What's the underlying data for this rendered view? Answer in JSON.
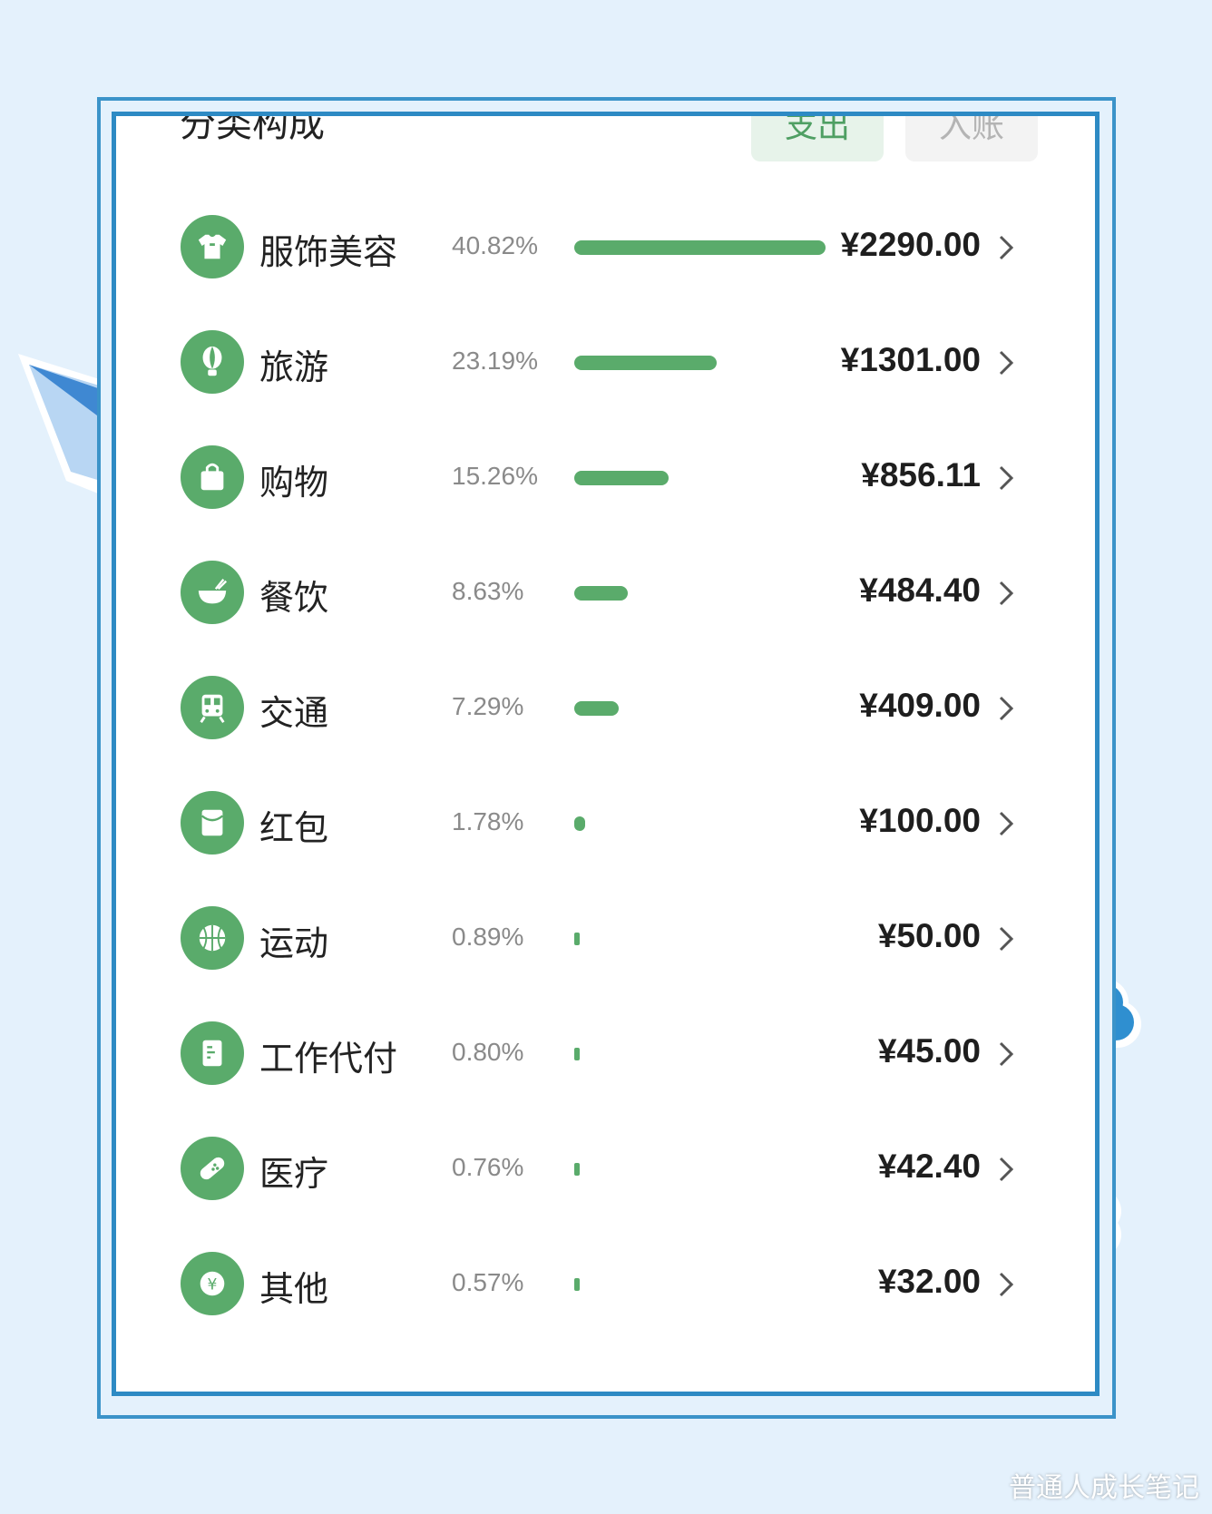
{
  "header": {
    "title": "分类构成",
    "tab_expense": "支出",
    "tab_income": "入账"
  },
  "colors": {
    "accent": "#5aab6b",
    "frame": "#2d8ac4",
    "background": "#e4f1fc"
  },
  "categories": [
    {
      "name": "服饰美容",
      "percent": "40.82%",
      "amount": "¥2290.00",
      "share": 0.4082,
      "icon": "shirt-icon"
    },
    {
      "name": "旅游",
      "percent": "23.19%",
      "amount": "¥1301.00",
      "share": 0.2319,
      "icon": "hot-air-balloon-icon"
    },
    {
      "name": "购物",
      "percent": "15.26%",
      "amount": "¥856.11",
      "share": 0.1526,
      "icon": "shopping-bag-icon"
    },
    {
      "name": "餐饮",
      "percent": "8.63%",
      "amount": "¥484.40",
      "share": 0.0863,
      "icon": "bowl-icon"
    },
    {
      "name": "交通",
      "percent": "7.29%",
      "amount": "¥409.00",
      "share": 0.0729,
      "icon": "train-icon"
    },
    {
      "name": "红包",
      "percent": "1.78%",
      "amount": "¥100.00",
      "share": 0.0178,
      "icon": "red-envelope-icon"
    },
    {
      "name": "运动",
      "percent": "0.89%",
      "amount": "¥50.00",
      "share": 0.0089,
      "icon": "basketball-icon"
    },
    {
      "name": "工作代付",
      "percent": "0.80%",
      "amount": "¥45.00",
      "share": 0.008,
      "icon": "document-icon"
    },
    {
      "name": "医疗",
      "percent": "0.76%",
      "amount": "¥42.40",
      "share": 0.0076,
      "icon": "bandage-icon"
    },
    {
      "name": "其他",
      "percent": "0.57%",
      "amount": "¥32.00",
      "share": 0.0057,
      "icon": "yen-coin-icon"
    }
  ],
  "watermark": "普通人成长笔记"
}
